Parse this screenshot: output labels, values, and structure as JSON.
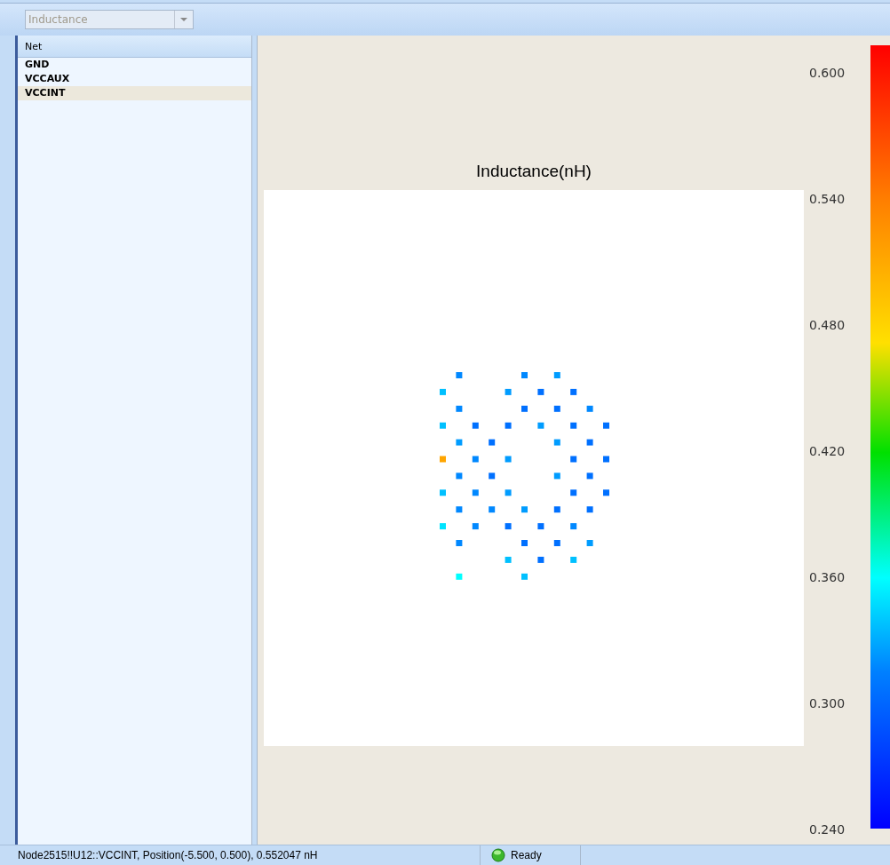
{
  "toolbar": {
    "combo": {
      "value": "Inductance",
      "disabled": true
    }
  },
  "net_list": {
    "header": "Net",
    "items": [
      {
        "label": "GND",
        "selected": false
      },
      {
        "label": "VCCAUX",
        "selected": false
      },
      {
        "label": "VCCINT",
        "selected": true
      }
    ]
  },
  "plot": {
    "title": "Inductance(nH)"
  },
  "colorbar": {
    "ticks": [
      "0.600",
      "0.540",
      "0.480",
      "0.420",
      "0.360",
      "0.300",
      "0.240"
    ]
  },
  "status_bar": {
    "message": "Node2515!!U12::VCCINT, Position(-5.500, 0.500), 0.552047 nH",
    "status": "Ready"
  }
}
